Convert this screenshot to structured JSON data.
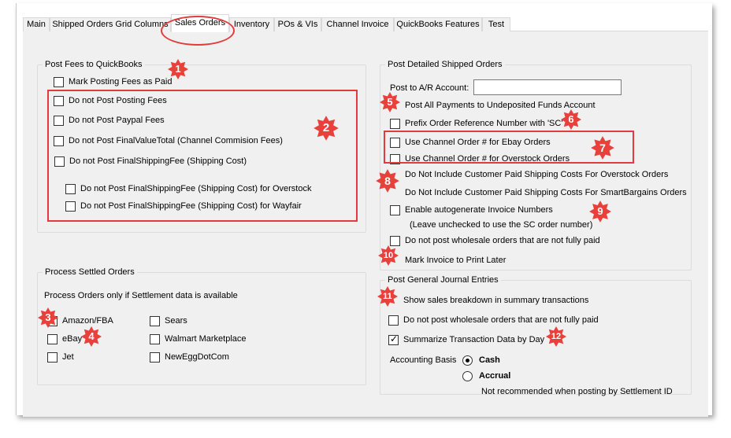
{
  "tabs": [
    {
      "label": "Main"
    },
    {
      "label": "Shipped Orders Grid Columns"
    },
    {
      "label": "Sales Orders"
    },
    {
      "label": "Inventory"
    },
    {
      "label": "POs & VIs"
    },
    {
      "label": "Channel Invoice"
    },
    {
      "label": "QuickBooks Features"
    },
    {
      "label": "Test"
    }
  ],
  "post_fees": {
    "title": "Post Fees to QuickBooks",
    "mark_paid": {
      "label": "Mark Posting Fees as Paid",
      "checked": false
    },
    "items": [
      {
        "label": "Do not Post Posting Fees",
        "checked": false
      },
      {
        "label": "Do not Post Paypal Fees",
        "checked": false
      },
      {
        "label": "Do not Post FinalValueTotal (Channel Commision Fees)",
        "checked": false
      },
      {
        "label": "Do not Post FinalShippingFee (Shipping Cost)",
        "checked": false
      },
      {
        "label": "Do not Post FinalShippingFee (Shipping Cost) for Overstock",
        "checked": false
      },
      {
        "label": "Do not Post FinalShippingFee (Shipping Cost) for Wayfair",
        "checked": false
      }
    ]
  },
  "settled": {
    "title": "Process Settled Orders",
    "note": "Process Orders only if Settlement data is available",
    "col1": [
      {
        "label": "Amazon/FBA",
        "checked": false
      },
      {
        "label": "eBay",
        "checked": false
      },
      {
        "label": "Jet",
        "checked": false
      }
    ],
    "col2": [
      {
        "label": "Sears",
        "checked": false
      },
      {
        "label": "Walmart Marketplace",
        "checked": false
      },
      {
        "label": "NewEggDotCom",
        "checked": false
      }
    ]
  },
  "detailed": {
    "title": "Post Detailed Shipped Orders",
    "ar_label": "Post to A/R Account:",
    "ar_value": "",
    "items": [
      {
        "label": "Post All Payments to Undeposited Funds Account",
        "checked": false
      },
      {
        "label": "Prefix Order Reference Number with 'SC'",
        "checked": false
      },
      {
        "label": "Use Channel Order # for Ebay Orders",
        "checked": false
      },
      {
        "label": "Use Channel Order # for Overstock Orders",
        "checked": false
      },
      {
        "label": "Do Not Include Customer Paid Shipping Costs For Overstock Orders",
        "checked": false
      },
      {
        "label": "Do Not Include Customer Paid Shipping Costs For SmartBargains Orders",
        "checked": false
      },
      {
        "label": "Enable autogenerate Invoice Numbers",
        "checked": false
      },
      {
        "label": "Do not post wholesale orders that are not fully paid",
        "checked": false
      },
      {
        "label": "Mark Invoice to Print Later",
        "checked": false
      }
    ],
    "autogen_note": "(Leave unchecked to use the SC order number)"
  },
  "journal": {
    "title": "Post General Journal Entries",
    "items": [
      {
        "label": "Show sales breakdown in summary transactions",
        "checked": false
      },
      {
        "label": "Do not post wholesale orders that are not fully paid",
        "checked": false
      },
      {
        "label": "Summarize Transaction Data by Day",
        "checked": true
      }
    ],
    "basis_label": "Accounting Basis",
    "cash": {
      "label": "Cash",
      "selected": true
    },
    "accrual": {
      "label": "Accrual",
      "selected": false
    },
    "accrual_note": "Not recommended when posting by Settlement ID"
  },
  "badges": [
    "1",
    "2",
    "3",
    "4",
    "5",
    "6",
    "7",
    "8",
    "9",
    "10",
    "11",
    "12"
  ],
  "colors": {
    "annotation_red": "#e23b3b",
    "badge_red": "#e8403a"
  }
}
